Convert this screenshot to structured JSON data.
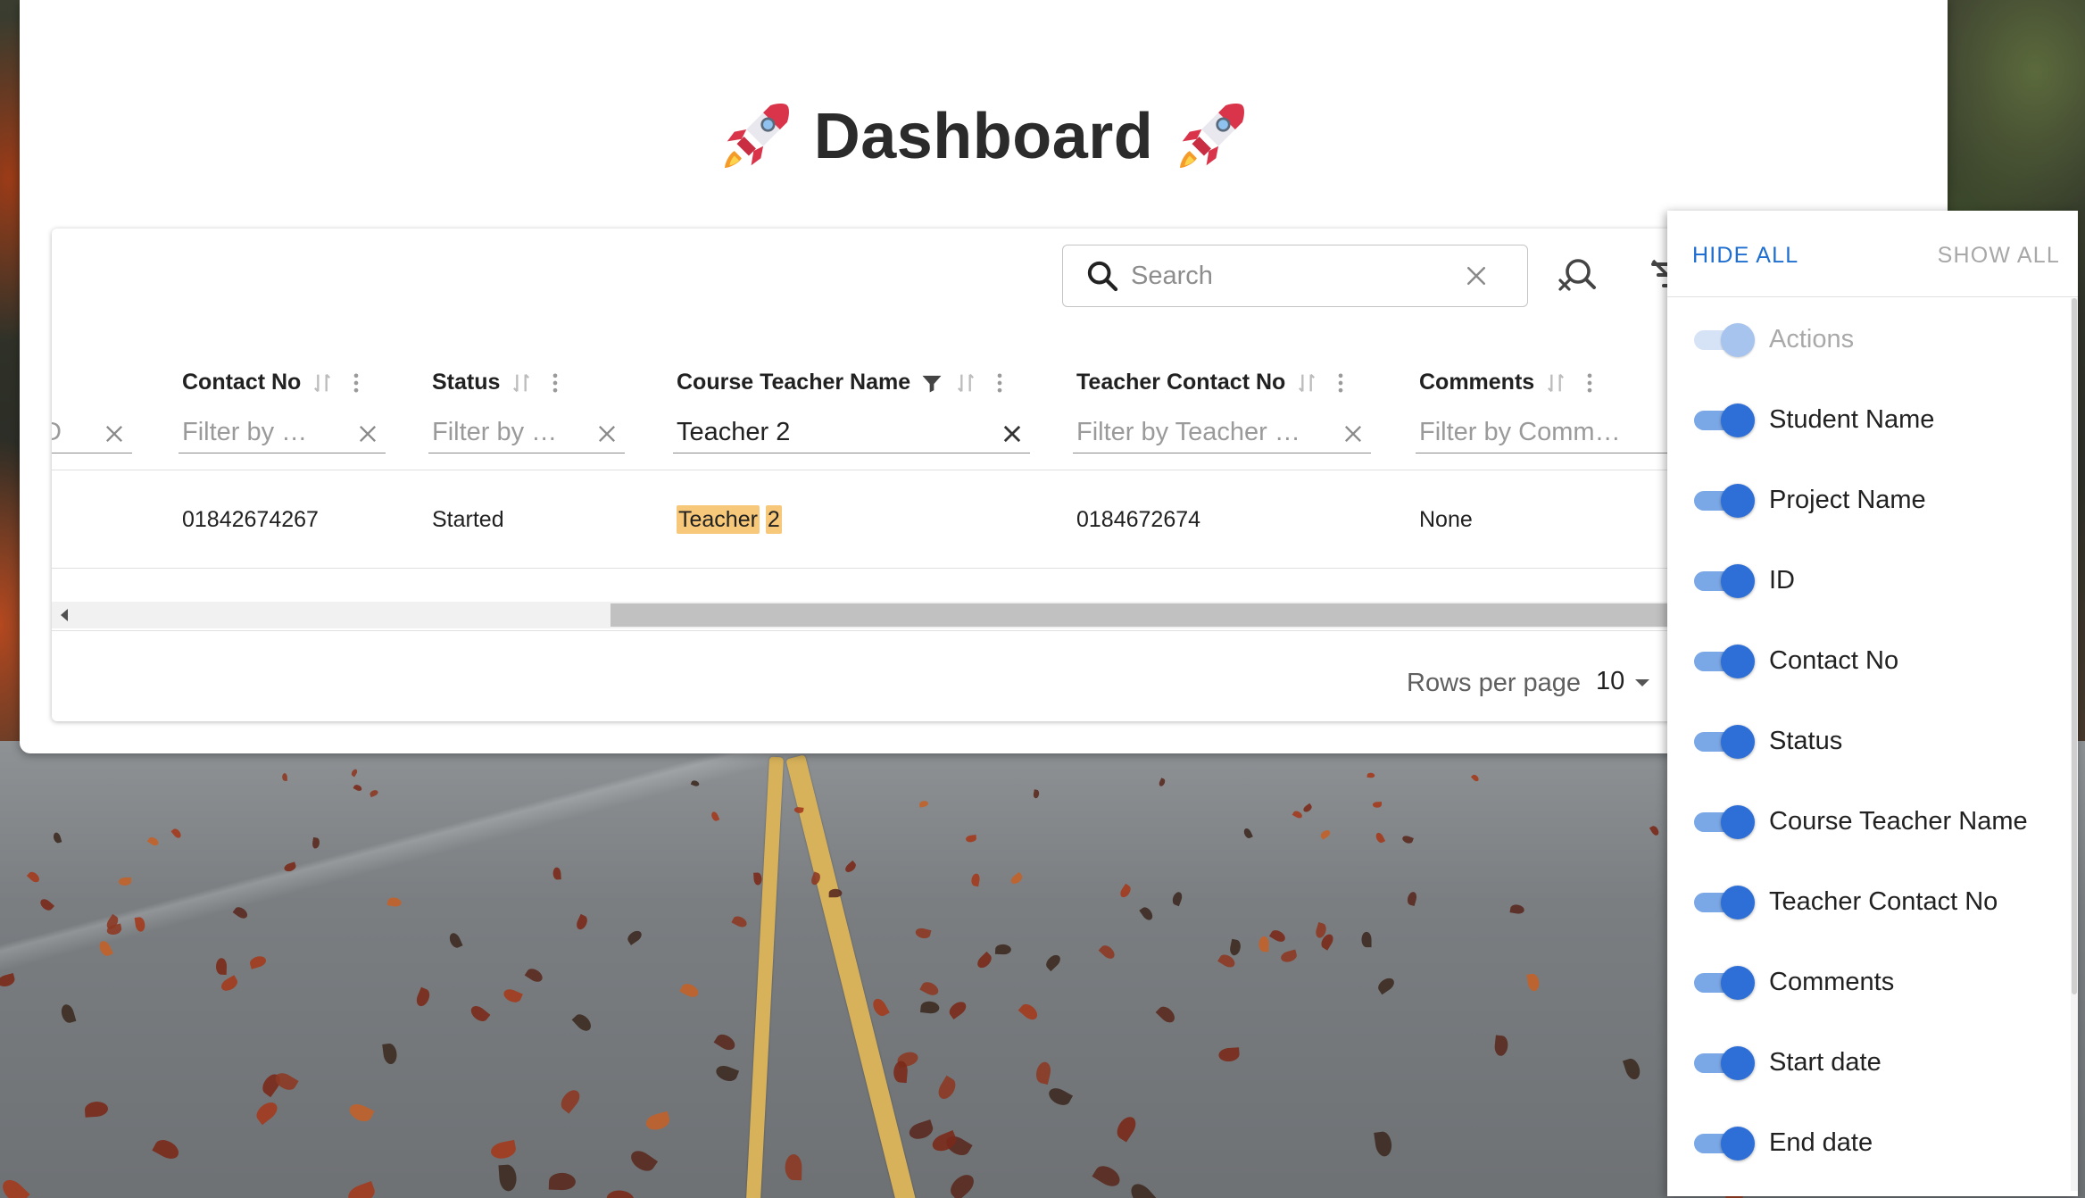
{
  "page": {
    "title": "Dashboard"
  },
  "toolbar": {
    "search_placeholder": "Search"
  },
  "columns": [
    {
      "title": "",
      "filter_placeholder": "",
      "filter_value": "",
      "partial": true
    },
    {
      "title": "Contact No",
      "filter_placeholder": "Filter by …",
      "filter_value": ""
    },
    {
      "title": "Status",
      "filter_placeholder": "Filter by …",
      "filter_value": ""
    },
    {
      "title": "Course Teacher Name",
      "filter_placeholder": "",
      "filter_value": "Teacher 2",
      "filtered": true
    },
    {
      "title": "Teacher Contact No",
      "filter_placeholder": "Filter by Teacher …",
      "filter_value": ""
    },
    {
      "title": "Comments",
      "filter_placeholder": "Filter by Comm…",
      "filter_value": ""
    }
  ],
  "rows": [
    {
      "contact_no": "01842674267",
      "status": "Started",
      "course_teacher_name_word1": "Teacher",
      "course_teacher_name_word2": "2",
      "teacher_contact_no": "0184672674",
      "comments": "None"
    }
  ],
  "pagination": {
    "rows_per_page_label": "Rows per page",
    "rows_per_page_value": "10"
  },
  "columns_panel": {
    "hide_all": "HIDE ALL",
    "show_all": "SHOW ALL",
    "items": [
      {
        "label": "Actions",
        "on": true,
        "disabled": true
      },
      {
        "label": "Student Name",
        "on": true
      },
      {
        "label": "Project Name",
        "on": true
      },
      {
        "label": "ID",
        "on": true
      },
      {
        "label": "Contact No",
        "on": true
      },
      {
        "label": "Status",
        "on": true
      },
      {
        "label": "Course Teacher Name",
        "on": true
      },
      {
        "label": "Teacher Contact No",
        "on": true
      },
      {
        "label": "Comments",
        "on": true
      },
      {
        "label": "Start date",
        "on": true
      },
      {
        "label": "End date",
        "on": true
      }
    ]
  },
  "colors": {
    "accent": "#1f6fd1",
    "switch_track": "#7aa7e6",
    "switch_knob": "#2d6fd6",
    "highlight": "#f7c87a"
  },
  "icons": [
    "rocket-icon",
    "search-icon",
    "clear-icon",
    "search-off-icon",
    "filter-off-icon",
    "sort-icon",
    "column-menu-icon",
    "filter-icon",
    "close-icon",
    "arrow-left-icon",
    "caret-down-icon"
  ]
}
